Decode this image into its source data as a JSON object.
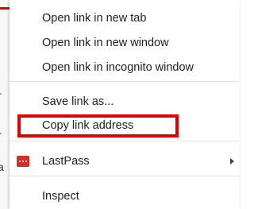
{
  "context_menu": {
    "items": [
      {
        "label": "Open link in new tab"
      },
      {
        "label": "Open link in new window"
      },
      {
        "label": "Open link in incognito window"
      },
      {
        "label": "Save link as..."
      },
      {
        "label": "Copy link address"
      },
      {
        "label": "LastPass"
      },
      {
        "label": "Inspect"
      }
    ]
  },
  "background_page": {
    "chars": [
      "r",
      "r",
      "a"
    ]
  },
  "colors": {
    "highlight": "#e00000",
    "lastpass_brand": "#d32d27"
  },
  "icons": {
    "lastpass": "lastpass-icon",
    "submenu": "chevron-right-icon"
  }
}
